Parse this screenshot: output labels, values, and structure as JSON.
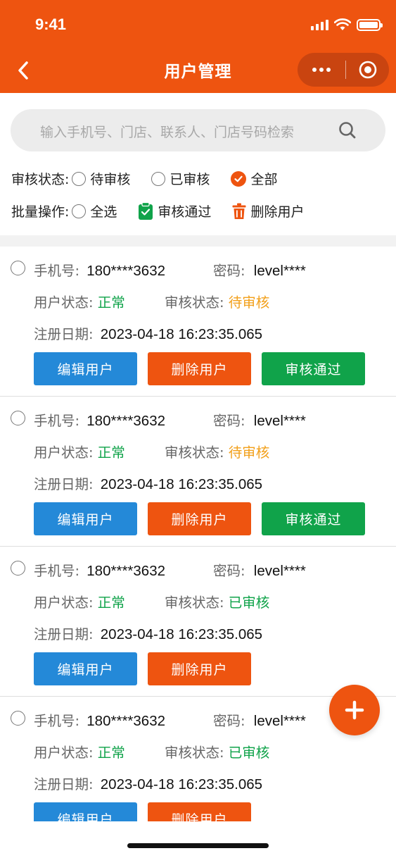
{
  "status_bar": {
    "time": "9:41"
  },
  "nav": {
    "title": "用户管理",
    "back_icon": "chevron-left-icon",
    "more_icon": "more-dots-icon",
    "close_icon": "target-close-icon"
  },
  "search": {
    "placeholder": "输入手机号、门店、联系人、门店号码检索",
    "icon": "search-icon"
  },
  "filters": {
    "audit_label": "审核状态:",
    "audit_options": [
      {
        "label": "待审核",
        "selected": false
      },
      {
        "label": "已审核",
        "selected": false
      },
      {
        "label": "全部",
        "selected": true
      }
    ],
    "batch_label": "批量操作:",
    "select_all": "全选",
    "approve": "审核通过",
    "delete": "删除用户"
  },
  "labels": {
    "phone": "手机号:",
    "password": "密码:",
    "user_status": "用户状态:",
    "audit_status": "审核状态:",
    "reg_date": "注册日期:"
  },
  "buttons": {
    "edit": "编辑用户",
    "delete": "删除用户",
    "approve": "审核通过"
  },
  "users": [
    {
      "phone": "180****3632",
      "password": "level****",
      "user_status": "正常",
      "audit_status": "待审核",
      "reg_date": "2023-04-18 16:23:35.065"
    },
    {
      "phone": "180****3632",
      "password": "level****",
      "user_status": "正常",
      "audit_status": "待审核",
      "reg_date": "2023-04-18 16:23:35.065"
    },
    {
      "phone": "180****3632",
      "password": "level****",
      "user_status": "正常",
      "audit_status": "已审核",
      "reg_date": "2023-04-18 16:23:35.065"
    },
    {
      "phone": "180****3632",
      "password": "level****",
      "user_status": "正常",
      "audit_status": "已审核",
      "reg_date": "2023-04-18 16:23:35.065"
    }
  ],
  "colors": {
    "brand": "#ee5410",
    "blue": "#2489d8",
    "green": "#10a34a",
    "pending": "#f2a01b"
  },
  "fab_icon": "plus-icon"
}
